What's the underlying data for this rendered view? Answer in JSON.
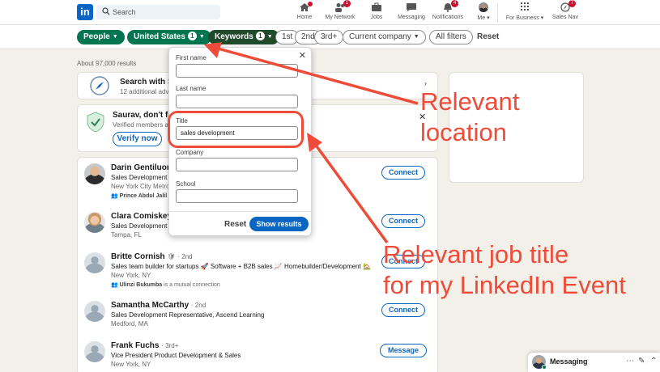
{
  "nav": {
    "logo": "in",
    "search_placeholder": "Search",
    "items": [
      {
        "label": "Home",
        "badge": "",
        "icon": "home-icon"
      },
      {
        "label": "My Network",
        "badge": "1",
        "icon": "network-icon"
      },
      {
        "label": "Jobs",
        "badge": "",
        "icon": "jobs-icon"
      },
      {
        "label": "Messaging",
        "badge": "",
        "icon": "messaging-icon"
      },
      {
        "label": "Notifications",
        "badge": "4",
        "icon": "bell-icon"
      },
      {
        "label": "Me ▾",
        "badge": "",
        "icon": "avatar"
      },
      {
        "label": "For Business ▾",
        "badge": "",
        "icon": "grid-icon"
      },
      {
        "label": "Sales Nav",
        "badge": "7",
        "icon": "compass-icon"
      }
    ]
  },
  "filters": {
    "people": "People",
    "location": "United States",
    "location_count": "1",
    "keywords": "Keywords",
    "keywords_count": "1",
    "first": "1st",
    "second": "2nd",
    "third": "3rd+",
    "current_company": "Current company",
    "all_filters": "All filters",
    "reset": "Reset"
  },
  "results_count": "About 97,000 results",
  "save_search": {
    "title": "Search with Sa",
    "sub": "12 additional adv"
  },
  "verify": {
    "title": "Saurav, don't fo",
    "sub": "Verified members a",
    "button": "Verify now"
  },
  "people": [
    {
      "name": "Darin Gentiluomo",
      "degree": "",
      "title": "Sales Development",
      "location": "New York City Metro",
      "mutual_name": "Prince Abdul Jalil",
      "mutual_text": "",
      "action": "Connect"
    },
    {
      "name": "Clara Comiskey",
      "degree": "",
      "title": "Sales Development",
      "location": "Tampa, FL",
      "mutual_name": "",
      "mutual_text": "",
      "action": "Connect"
    },
    {
      "name": "Britte Cornish",
      "degree": "· 2nd",
      "title": "Sales team builder for startups 🚀 Software + B2B sales 📈 Homebuilder/Development 🏡",
      "location": "New York, NY",
      "mutual_name": "Ulinzi Bukumba",
      "mutual_text": " is a mutual connection",
      "action": "Connect"
    },
    {
      "name": "Samantha McCarthy",
      "degree": "· 2nd",
      "title": "Sales Development Representative, Ascend Learning",
      "location": "Medford, MA",
      "mutual_name": "",
      "mutual_text": "",
      "action": "Connect"
    },
    {
      "name": "Frank Fuchs",
      "degree": "· 3rd+",
      "title": "Vice President Product Development & Sales",
      "location": "New York, NY",
      "mutual_name": "",
      "mutual_text": "",
      "action": "Message"
    }
  ],
  "dropdown": {
    "first_name_label": "First name",
    "first_name_value": "",
    "last_name_label": "Last name",
    "last_name_value": "",
    "title_label": "Title",
    "title_value": "sales development",
    "company_label": "Company",
    "company_value": "",
    "school_label": "School",
    "school_value": "",
    "reset": "Reset",
    "show_results": "Show results"
  },
  "annotations": {
    "location_line1": "Relevant",
    "location_line2": "location",
    "title_line1": "Relevant job title",
    "title_line2": "for my LinkedIn Event",
    "color": "#ee4c3a"
  },
  "messaging": {
    "label": "Messaging"
  },
  "colors": {
    "brand": "#0a66c2",
    "filter_green": "#01754f",
    "badge": "#cb112d"
  }
}
